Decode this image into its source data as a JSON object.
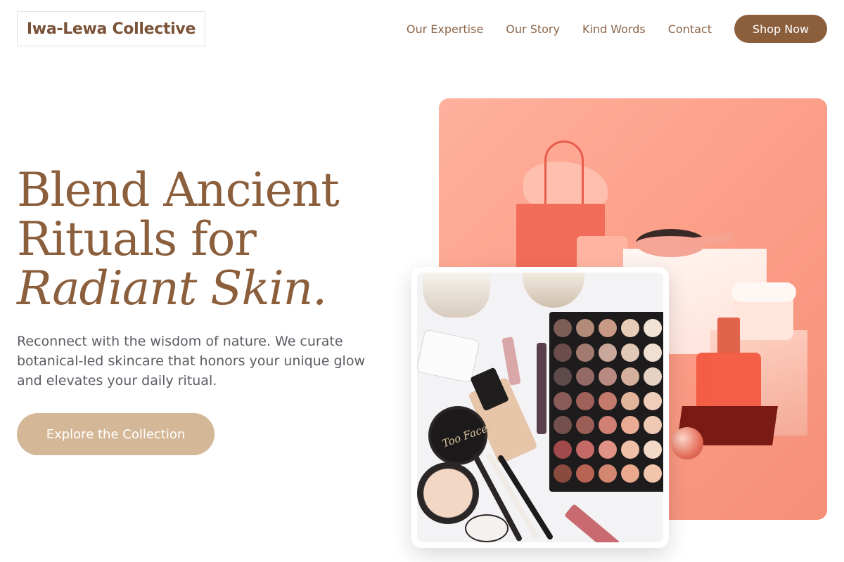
{
  "header": {
    "logo": "Iwa-Lewa Collective",
    "nav": [
      "Our Expertise",
      "Our Story",
      "Kind Words",
      "Contact"
    ],
    "cta": "Shop Now"
  },
  "hero": {
    "title_line1": "Blend Ancient",
    "title_line2": "Rituals for",
    "title_line3": "Radiant Skin.",
    "subtitle": "Reconnect with the wisdom of nature. We curate botanical-led skincare that honors your unique glow and elevates your daily ritual.",
    "button": "Explore the Collection"
  },
  "images": {
    "main": "coral cosmetics still life",
    "card": "makeup flat lay",
    "card_brand_text": "Too Faced"
  },
  "colors": {
    "brand": "#8b5e3c",
    "cta_secondary": "#d4b796",
    "coral": "#fca08a"
  }
}
